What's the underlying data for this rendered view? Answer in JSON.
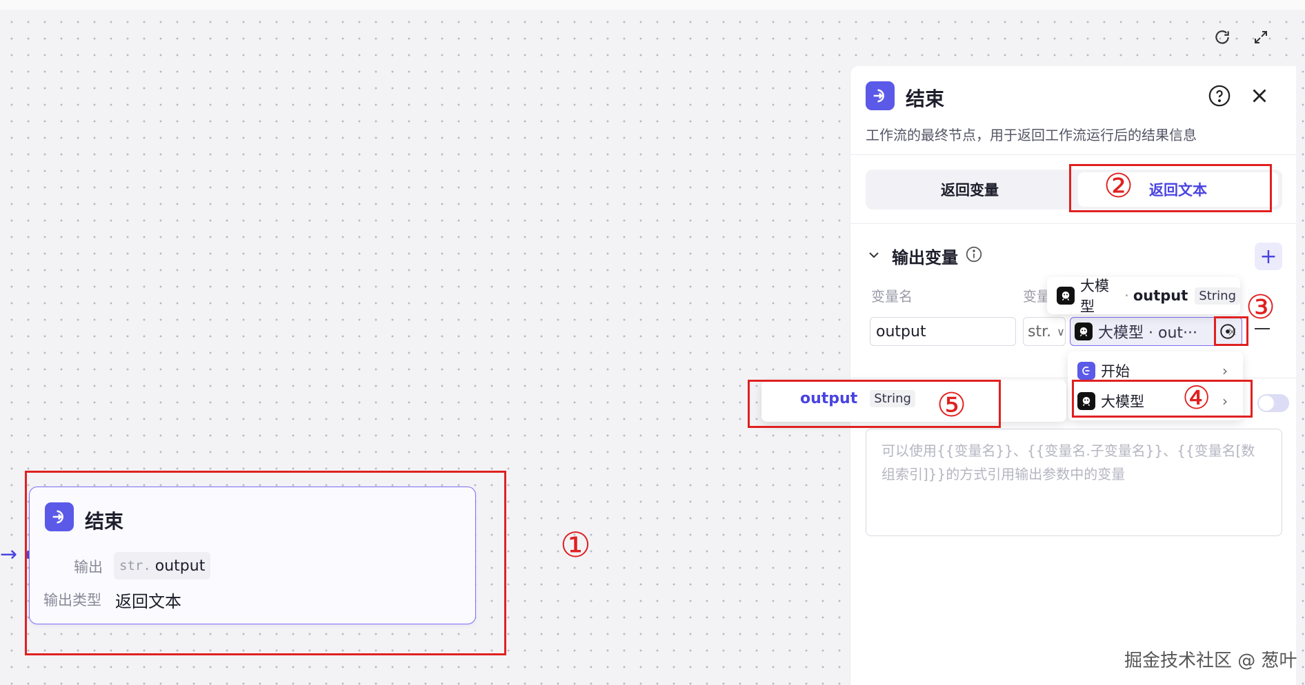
{
  "canvas": {
    "node": {
      "title": "结束",
      "output_label": "输出",
      "output_type_tag": "str.",
      "output_var": "output",
      "output_type_label": "输出类型",
      "output_type_value": "返回文本"
    }
  },
  "panel": {
    "title": "结束",
    "description": "工作流的最终节点，用于返回工作流运行后的结果信息",
    "tabs": [
      {
        "label": "返回变量",
        "active": false
      },
      {
        "label": "返回文本",
        "active": true
      }
    ],
    "output_section": {
      "title": "输出变量",
      "col_name": "变量名",
      "col_value": "变量",
      "var_name": "output",
      "type_short": "str.",
      "ref_value": "大模型 · out···"
    },
    "text_placeholder": "可以使用{{变量名}}、{{变量名.子变量名}}、{{变量名[数组索引]}}的方式引用输出参数中的变量"
  },
  "popups": {
    "tooltip": {
      "source": "大模型",
      "dot": "·",
      "var": "output",
      "type": "String"
    },
    "menu": [
      {
        "label": "开始"
      },
      {
        "label": "大模型"
      }
    ],
    "submenu": {
      "var": "output",
      "type": "String"
    }
  },
  "annotations": [
    "①",
    "②",
    "③",
    "④",
    "⑤"
  ],
  "watermark": "掘金技术社区 @ 葱叶",
  "colors": {
    "accent": "#4a44e0",
    "annotation_red": "#e02020"
  }
}
